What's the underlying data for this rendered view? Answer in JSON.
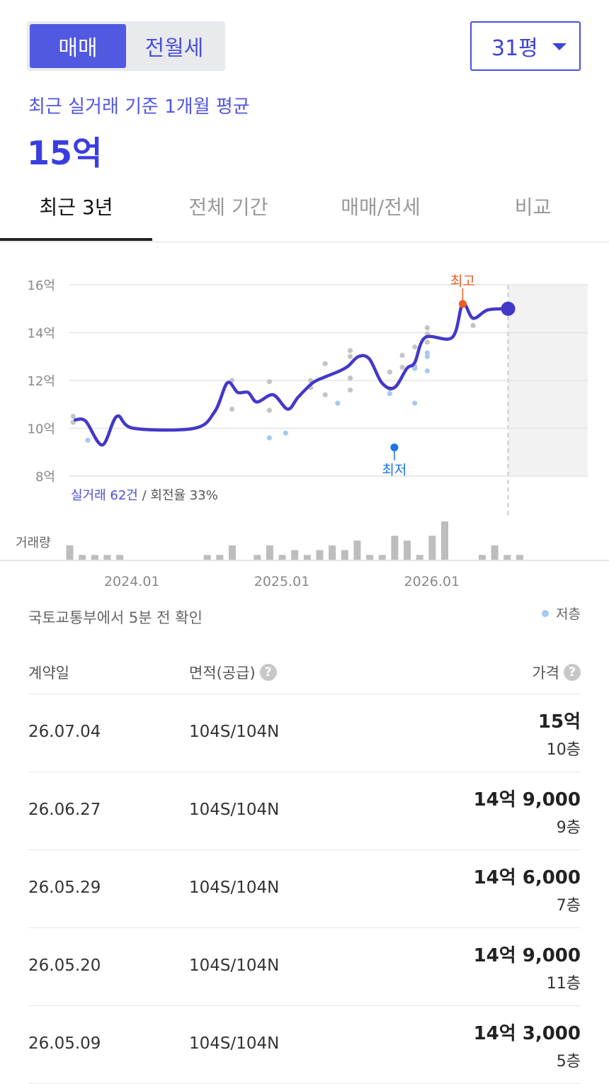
{
  "tabs_top": {
    "sale": "매매",
    "rent": "전월세"
  },
  "size_select": {
    "value": "31평"
  },
  "summary": {
    "subtitle": "최근 실거래 기준 1개월 평균",
    "average_price": "15억"
  },
  "period_tabs": [
    "최근 3년",
    "전체 기간",
    "매매/전세",
    "비교"
  ],
  "chart_data": {
    "type": "line",
    "y_ticks": [
      "16억",
      "14억",
      "12억",
      "10억",
      "8억"
    ],
    "y_unit": "억",
    "ylim": [
      8,
      16
    ],
    "x_ticks": [
      {
        "label": "2024.01",
        "x": "2024-01"
      },
      {
        "label": "2025.01",
        "x": "2025-01"
      },
      {
        "label": "2026.01",
        "x": "2026-01"
      }
    ],
    "volume_label": "거래량",
    "trade_count_label": "실거래 62건",
    "turnover_label": " / 회전율 33%",
    "high_label": "최고",
    "low_label": "최저",
    "colors": {
      "line": "#4338ca",
      "high": "#f05a24",
      "low": "#1a73e8",
      "dot": "#c4c4c4",
      "low_floor_dot": "#a8c8f0",
      "volume": "#bdbdbd"
    },
    "series": [
      {
        "points": [
          [
            "2023-08-15",
            10.35
          ],
          [
            "2023-09-10",
            10.3
          ],
          [
            "2023-10-20",
            9.3
          ],
          [
            "2023-11-25",
            10.5
          ],
          [
            "2024-01-05",
            10.0
          ],
          [
            "2024-06-01",
            10.0
          ],
          [
            "2024-07-20",
            10.7
          ],
          [
            "2024-08-20",
            11.9
          ],
          [
            "2024-09-15",
            11.5
          ],
          [
            "2024-10-10",
            11.5
          ],
          [
            "2024-11-01",
            11.1
          ],
          [
            "2024-12-10",
            11.4
          ],
          [
            "2025-01-15",
            10.8
          ],
          [
            "2025-02-10",
            11.3
          ],
          [
            "2025-03-15",
            11.9
          ],
          [
            "2025-04-15",
            12.15
          ],
          [
            "2025-05-20",
            12.4
          ],
          [
            "2025-06-10",
            12.6
          ],
          [
            "2025-07-05",
            13.0
          ],
          [
            "2025-08-01",
            12.9
          ],
          [
            "2025-09-01",
            11.9
          ],
          [
            "2025-10-01",
            11.7
          ],
          [
            "2025-11-01",
            12.5
          ],
          [
            "2025-11-20",
            12.75
          ],
          [
            "2025-12-15",
            13.8
          ],
          [
            "2026-02-20",
            13.8
          ],
          [
            "2026-03-15",
            15.2
          ],
          [
            "2026-04-10",
            14.6
          ],
          [
            "2026-05-15",
            14.95
          ],
          [
            "2026-07-04",
            15.0
          ]
        ]
      }
    ],
    "deals": [
      [
        "2023-08-10",
        10.5,
        0
      ],
      [
        "2023-08-10",
        10.25,
        0
      ],
      [
        "2023-09-15",
        9.5,
        1
      ],
      [
        "2024-09-01",
        12.0,
        0
      ],
      [
        "2024-09-01",
        10.8,
        0
      ],
      [
        "2024-12-01",
        11.95,
        0
      ],
      [
        "2024-12-01",
        10.75,
        0
      ],
      [
        "2024-12-01",
        9.6,
        1
      ],
      [
        "2025-01-10",
        9.8,
        1
      ],
      [
        "2025-03-10",
        12.0,
        0
      ],
      [
        "2025-03-10",
        11.7,
        0
      ],
      [
        "2025-04-15",
        12.7,
        0
      ],
      [
        "2025-04-15",
        11.4,
        0
      ],
      [
        "2025-05-15",
        11.05,
        1
      ],
      [
        "2025-06-15",
        13.25,
        0
      ],
      [
        "2025-06-15",
        13.0,
        0
      ],
      [
        "2025-06-15",
        12.1,
        0
      ],
      [
        "2025-06-15",
        11.6,
        0
      ],
      [
        "2025-09-20",
        12.35,
        0
      ],
      [
        "2025-09-20",
        11.65,
        0
      ],
      [
        "2025-09-20",
        11.45,
        1
      ],
      [
        "2025-10-20",
        13.05,
        0
      ],
      [
        "2025-10-20",
        12.55,
        0
      ],
      [
        "2025-11-20",
        13.4,
        0
      ],
      [
        "2025-11-20",
        12.6,
        0
      ],
      [
        "2025-11-20",
        12.5,
        1
      ],
      [
        "2025-11-20",
        11.05,
        1
      ],
      [
        "2025-12-20",
        14.2,
        0
      ],
      [
        "2025-12-20",
        13.95,
        0
      ],
      [
        "2025-12-20",
        13.6,
        0
      ],
      [
        "2025-12-20",
        13.15,
        1
      ],
      [
        "2025-12-20",
        13.0,
        1
      ],
      [
        "2025-12-20",
        12.4,
        1
      ],
      [
        "2026-04-10",
        14.3,
        0
      ]
    ],
    "high_point": [
      "2026-03-15",
      15.2
    ],
    "low_point": [
      "2025-10-01",
      9.2
    ],
    "current_point": [
      "2026-07-04",
      15.0
    ],
    "forecast_start": "2026-07-04",
    "volume": [
      [
        "2023-08",
        3
      ],
      [
        "2023-09",
        1
      ],
      [
        "2023-10",
        1
      ],
      [
        "2023-11",
        1
      ],
      [
        "2023-12",
        1
      ],
      [
        "2024-07",
        1
      ],
      [
        "2024-08",
        1
      ],
      [
        "2024-09",
        3
      ],
      [
        "2024-11",
        1
      ],
      [
        "2024-12",
        3
      ],
      [
        "2025-01",
        1
      ],
      [
        "2025-02",
        2
      ],
      [
        "2025-03",
        1
      ],
      [
        "2025-04",
        2
      ],
      [
        "2025-05",
        3
      ],
      [
        "2025-06",
        2
      ],
      [
        "2025-07",
        4
      ],
      [
        "2025-08",
        1
      ],
      [
        "2025-09",
        1
      ],
      [
        "2025-10",
        5
      ],
      [
        "2025-11",
        4
      ],
      [
        "2025-12",
        1
      ],
      [
        "2026-01",
        5
      ],
      [
        "2026-02",
        8
      ],
      [
        "2026-05",
        1
      ],
      [
        "2026-06",
        3
      ],
      [
        "2026-07",
        1
      ],
      [
        "2026-08",
        1
      ]
    ]
  },
  "source_text": "국토교통부에서 5분 전 확인",
  "legend": {
    "low_floor": "저층"
  },
  "table": {
    "headers": {
      "date": "계약일",
      "area": "면적(공급)",
      "price": "가격"
    },
    "rows": [
      {
        "date": "26.07.04",
        "area": "104S/104N",
        "price": "15억",
        "floor": "10층"
      },
      {
        "date": "26.06.27",
        "area": "104S/104N",
        "price": "14억 9,000",
        "floor": "9층"
      },
      {
        "date": "26.05.29",
        "area": "104S/104N",
        "price": "14억 6,000",
        "floor": "7층"
      },
      {
        "date": "26.05.20",
        "area": "104S/104N",
        "price": "14억 9,000",
        "floor": "11층"
      },
      {
        "date": "26.05.09",
        "area": "104S/104N",
        "price": "14억 3,000",
        "floor": "5층"
      }
    ]
  }
}
